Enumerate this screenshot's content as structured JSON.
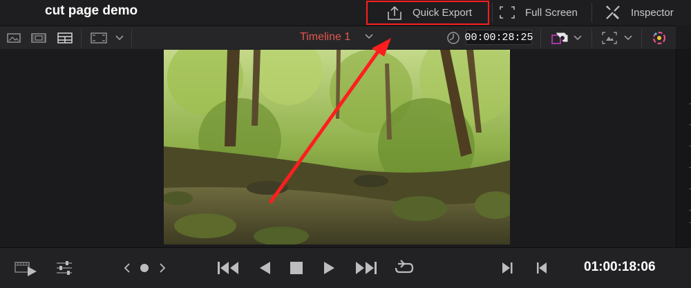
{
  "project": {
    "title": "cut page demo"
  },
  "top_buttons": {
    "quick_export": "Quick Export",
    "full_screen": "Full Screen",
    "inspector": "Inspector"
  },
  "viewer_toolbar": {
    "timeline_name": "Timeline 1",
    "timeline_color": "#e2574c",
    "duration_timecode": "00:00:28:25"
  },
  "scale_ticks": [
    "-",
    "-",
    "-",
    "-",
    "-",
    "-",
    "-"
  ],
  "transport": {
    "current_timecode": "01:00:18:06"
  },
  "highlight": {
    "color": "#ff1e1e"
  },
  "icons": [
    "image-icon",
    "film-strip-icon",
    "multi-view-icon",
    "viewer-size-icon",
    "chevron-down-icon",
    "quick-export-icon",
    "full-screen-icon",
    "inspector-icon",
    "clock-icon",
    "camera-icon",
    "transform-icon",
    "color-wheel-icon",
    "play-clip-icon",
    "sliders-icon",
    "prev-icon",
    "dot-icon",
    "next-icon",
    "skip-back-icon",
    "play-reverse-icon",
    "stop-icon",
    "play-icon",
    "skip-forward-icon",
    "loop-icon",
    "mark-in-icon",
    "mark-out-icon"
  ]
}
